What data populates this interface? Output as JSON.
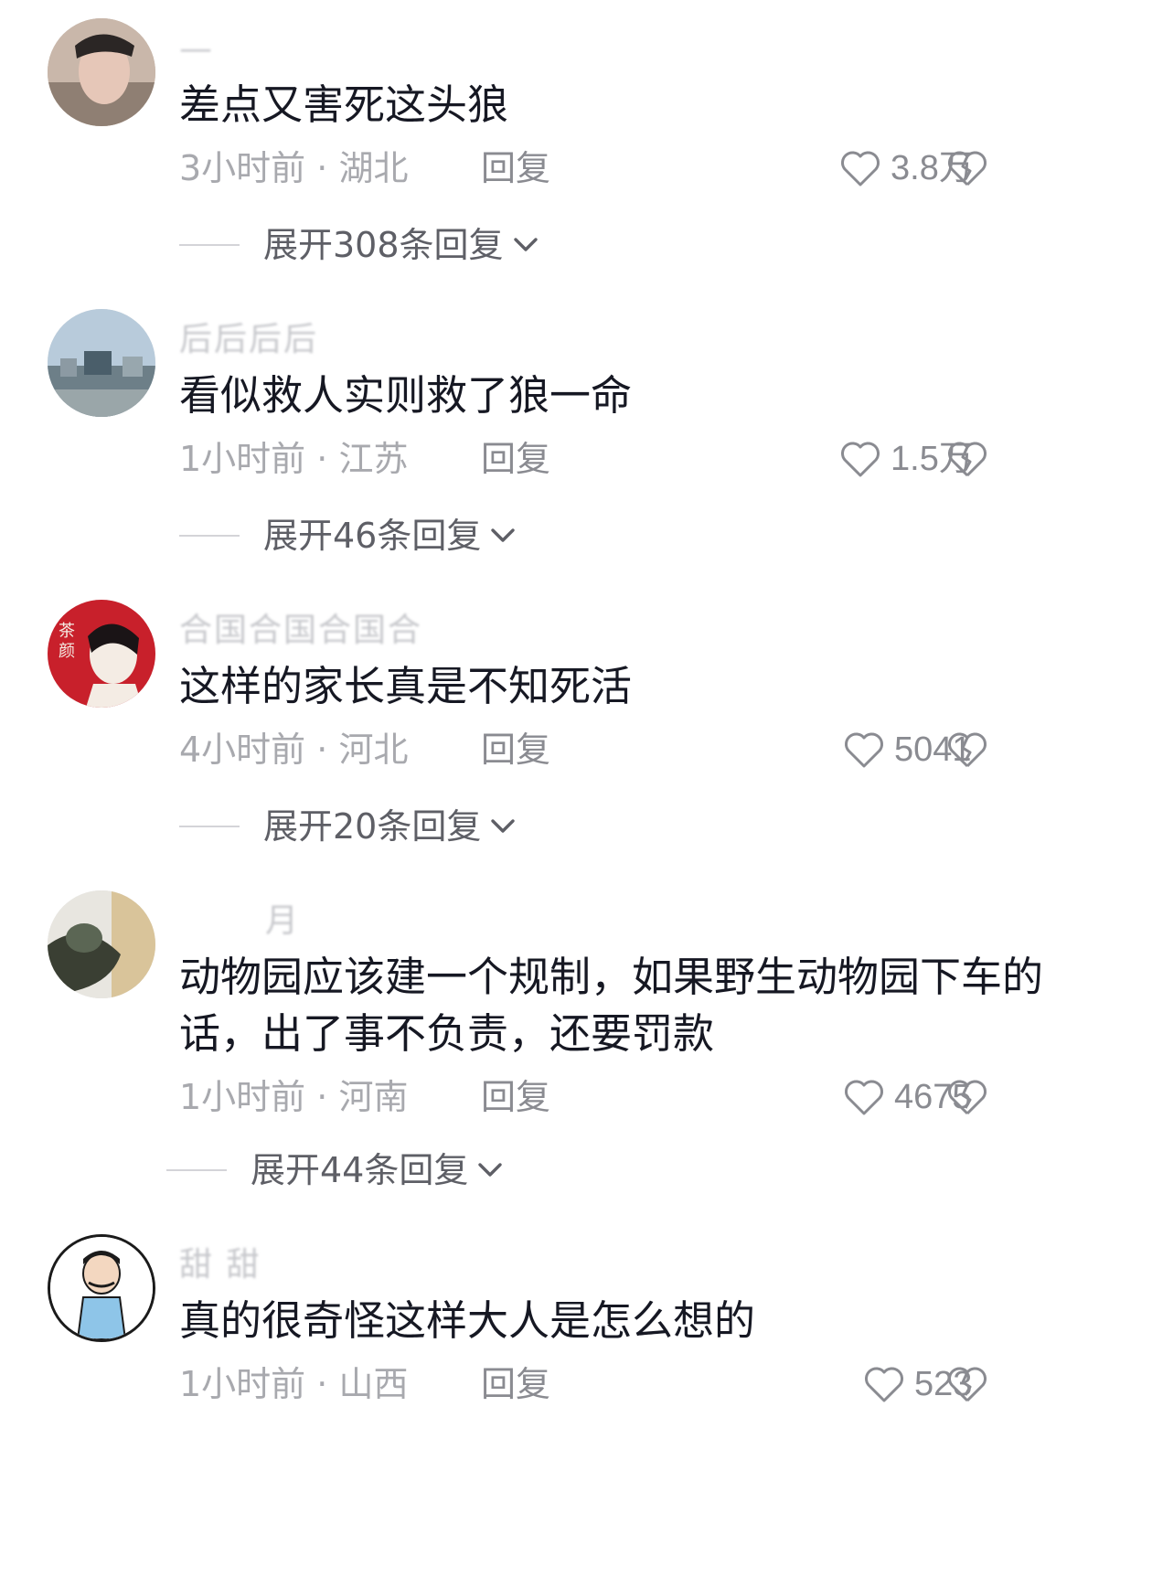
{
  "comments": [
    {
      "username": "—",
      "text": "差点又害死这头狼",
      "time": "3小时前",
      "location": "湖北",
      "reply_label": "回复",
      "likes": "3.8万",
      "expand_label": "展开308条回复"
    },
    {
      "username": "后后后后",
      "text": "看似救人实则救了狼一命",
      "time": "1小时前",
      "location": "江苏",
      "reply_label": "回复",
      "likes": "1.5万",
      "expand_label": "展开46条回复"
    },
    {
      "username": "合国合国合国合",
      "text": "这样的家长真是不知死活",
      "time": "4小时前",
      "location": "河北",
      "reply_label": "回复",
      "likes": "5041",
      "expand_label": "展开20条回复"
    },
    {
      "username": "月",
      "text": "动物园应该建一个规制，如果野生动物园下车的话，出了事不负责，还要罚款",
      "time": "1小时前",
      "location": "河南",
      "reply_label": "回复",
      "likes": "4675",
      "expand_label": "展开44条回复"
    },
    {
      "username": "甜 甜",
      "text": "真的很奇怪这样大人是怎么想的",
      "time": "1小时前",
      "location": "山西",
      "reply_label": "回复",
      "likes": "523",
      "expand_label": ""
    }
  ],
  "separator": " · ",
  "colors": {
    "text_primary": "#161823",
    "text_secondary": "#a8a9ae",
    "icon": "#8a8b91"
  }
}
